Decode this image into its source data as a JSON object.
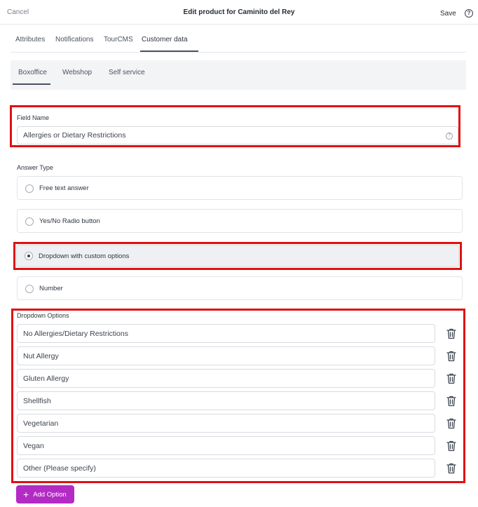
{
  "header": {
    "cancel_label": "Cancel",
    "title": "Edit product for Caminito del Rey",
    "save_label": "Save",
    "help_icon": "?"
  },
  "tabs": [
    {
      "label": "Attributes"
    },
    {
      "label": "Notifications"
    },
    {
      "label": "TourCMS"
    },
    {
      "label": "Customer data"
    }
  ],
  "active_tab": "Customer data",
  "subtabs": [
    {
      "label": "Boxoffice"
    },
    {
      "label": "Webshop"
    },
    {
      "label": "Self service"
    }
  ],
  "active_subtab": "Boxoffice",
  "field_name": {
    "label": "Field Name",
    "value": "Allergies or Dietary Restrictions",
    "help_icon": "?"
  },
  "answer_type": {
    "label": "Answer Type",
    "options": [
      {
        "label": "Free text answer",
        "selected": false
      },
      {
        "label": "Yes/No Radio button",
        "selected": false
      },
      {
        "label": "Dropdown with custom options",
        "selected": true
      },
      {
        "label": "Number",
        "selected": false
      }
    ]
  },
  "dropdown_options": {
    "label": "Dropdown Options",
    "items": [
      {
        "value": "No Allergies/Dietary Restrictions"
      },
      {
        "value": "Nut Allergy"
      },
      {
        "value": "Gluten Allergy"
      },
      {
        "value": "Shellfish"
      },
      {
        "value": "Vegetarian"
      },
      {
        "value": "Vegan"
      },
      {
        "value": "Other (Please specify)"
      }
    ],
    "add_label": "Add Option"
  },
  "icons": {
    "help": "question-circle-icon",
    "delete": "trash-icon",
    "add": "plus-icon",
    "radio": "radio-button-icon"
  },
  "colors": {
    "highlight": "#e01010",
    "primary_button": "#b32bc4",
    "subtab_bar": "#f3f4f6"
  }
}
